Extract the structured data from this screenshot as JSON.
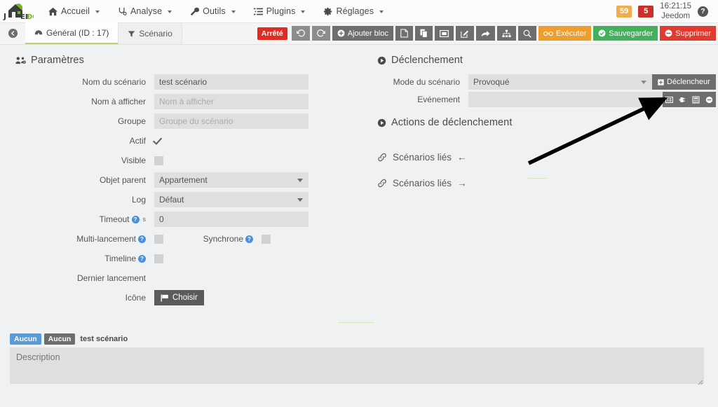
{
  "navbar": {
    "brand": "JEEDOM",
    "brand_part1": "J",
    "brand_part2": "EE",
    "brand_part3": "DOM",
    "items": [
      {
        "label": "Accueil",
        "icon": "home-icon"
      },
      {
        "label": "Analyse",
        "icon": "stethoscope-icon"
      },
      {
        "label": "Outils",
        "icon": "wrench-icon"
      },
      {
        "label": "Plugins",
        "icon": "list-icon"
      },
      {
        "label": "Réglages",
        "icon": "gear-icon"
      }
    ],
    "badge_warning": "59",
    "badge_danger": "5",
    "time": "16:21:15",
    "user": "Jeedom",
    "help": "?"
  },
  "tabbar": {
    "back": "back-icon",
    "tabs": [
      {
        "label": "Général (ID : 17)",
        "icon": "dashboard-icon",
        "active": true
      },
      {
        "label": "Scénario",
        "icon": "filter-icon",
        "active": false
      }
    ],
    "status": "Arrêté",
    "tools": [
      {
        "name": "undo-button",
        "label": "",
        "icon": "undo-icon",
        "style": "light"
      },
      {
        "name": "redo-button",
        "label": "",
        "icon": "redo-icon",
        "style": "light"
      },
      {
        "name": "add-block-button",
        "label": "Ajouter bloc",
        "icon": "plus-circle-icon",
        "style": "dark"
      },
      {
        "name": "new-button",
        "label": "",
        "icon": "file-icon",
        "style": "dark"
      },
      {
        "name": "duplicate-button",
        "label": "",
        "icon": "copy-icon",
        "style": "dark"
      },
      {
        "name": "image-button",
        "label": "",
        "icon": "image-icon",
        "style": "dark"
      },
      {
        "name": "edit-button",
        "label": "",
        "icon": "pencil-square-icon",
        "style": "dark"
      },
      {
        "name": "share-button",
        "label": "",
        "icon": "share-icon",
        "style": "dark"
      },
      {
        "name": "tree-button",
        "label": "",
        "icon": "sitemap-icon",
        "style": "dark"
      },
      {
        "name": "search-button",
        "label": "",
        "icon": "search-icon",
        "style": "dark"
      },
      {
        "name": "execute-button",
        "label": "Exécuter",
        "icon": "glasses-icon",
        "style": "orange"
      },
      {
        "name": "save-button",
        "label": "Sauvegarder",
        "icon": "check-circle-icon",
        "style": "green"
      },
      {
        "name": "delete-button",
        "label": "Supprimer",
        "icon": "minus-circle-icon",
        "style": "red"
      }
    ]
  },
  "parameters": {
    "title": "Paramètres",
    "icon": "users-cog-icon",
    "fields": {
      "name_label": "Nom du scénario",
      "name_value": "test scénario",
      "display_name_label": "Nom à afficher",
      "display_name_placeholder": "Nom à afficher",
      "display_name_value": "",
      "group_label": "Groupe",
      "group_placeholder": "Groupe du scénario",
      "group_value": "",
      "active_label": "Actif",
      "active_checked": true,
      "visible_label": "Visible",
      "visible_checked": false,
      "parent_label": "Objet parent",
      "parent_value": "Appartement",
      "log_label": "Log",
      "log_value": "Défaut",
      "timeout_label": "Timeout",
      "timeout_unit": "s",
      "timeout_value": "0",
      "multi_label": "Multi-lancement",
      "multi_checked": false,
      "sync_label": "Synchrone",
      "sync_checked": false,
      "timeline_label": "Timeline",
      "timeline_checked": false,
      "last_run_label": "Dernier lancement",
      "last_run_value": "",
      "icon_label": "Icône",
      "icon_button": "Choisir"
    }
  },
  "trigger": {
    "title": "Déclenchement",
    "mode_label": "Mode du scénario",
    "mode_value": "Provoqué",
    "trigger_button": "Déclencheur",
    "event_label": "Evénement",
    "event_value": "",
    "event_icons": [
      {
        "name": "list-display-icon"
      },
      {
        "name": "plug-icon"
      },
      {
        "name": "calculator-icon"
      },
      {
        "name": "minus-circle-icon"
      }
    ],
    "actions_title": "Actions de déclenchement",
    "linked_in": "Scénarios liés",
    "linked_in_arrow": "←",
    "linked_out": "Scénarios liés",
    "linked_out_arrow": "→"
  },
  "footer": {
    "chip_blue": "Aucun",
    "chip_gray": "Aucun",
    "chip_text": "test scénario",
    "description_placeholder": "Description",
    "description_value": ""
  },
  "colors": {
    "background": "#eff1f2",
    "input": "#dedfe0",
    "accent_green": "#b5d46a",
    "warn": "#f0ad4e",
    "danger": "#c9302c",
    "status_red": "#e02b20",
    "orange": "#ee9e2e",
    "green": "#45b05c",
    "red": "#e03b30",
    "chip_blue": "#5a9bd5"
  }
}
